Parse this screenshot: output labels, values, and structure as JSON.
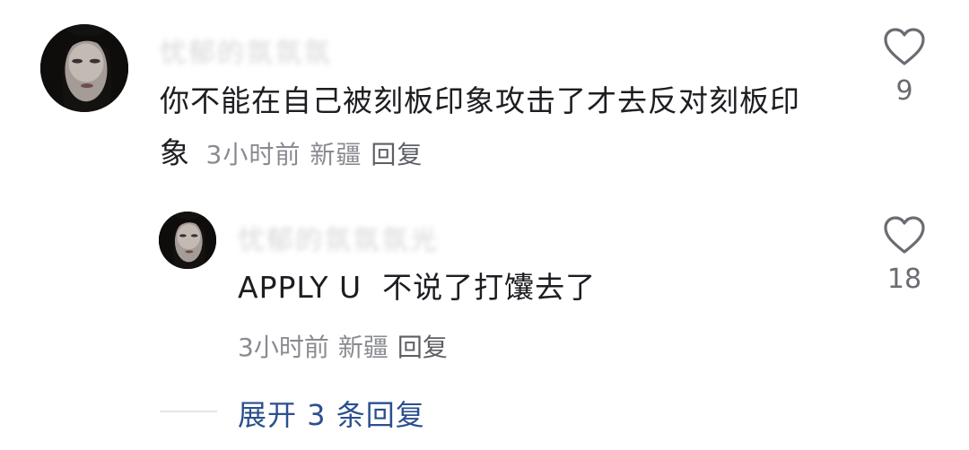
{
  "comment": {
    "username": "忧郁的氛氛氛",
    "text": "你不能在自己被刻板印象攻击了才去反对刻板印象",
    "time": "3小时前",
    "location": "新疆",
    "reply_label": "回复",
    "like_count": "9"
  },
  "reply": {
    "username": "忧郁的氛氛氛光",
    "text": "APPLY U  不说了打馕去了",
    "time": "3小时前",
    "location": "新疆",
    "reply_label": "回复",
    "like_count": "18"
  },
  "expand": {
    "label": "展开 3 条回复"
  },
  "icons": {
    "like": "heart-outline-icon",
    "expand": "chevron-down-icon"
  },
  "colors": {
    "text": "#1d1d22",
    "meta": "#8a8b91",
    "link": "#2b4f8e",
    "icon": "#6b6c72"
  }
}
